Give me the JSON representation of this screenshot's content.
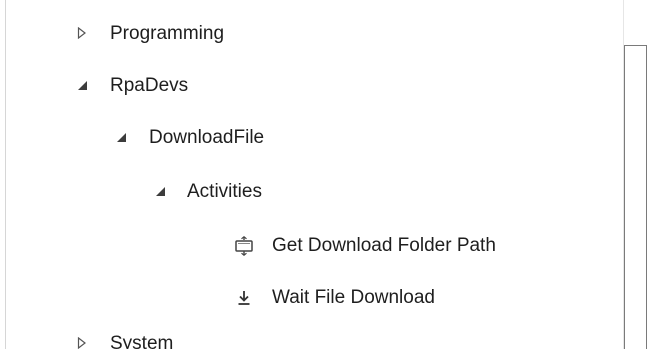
{
  "tree": {
    "items": [
      {
        "label": "Programming",
        "expanded": false,
        "icon": "triangle-right-outline-icon"
      },
      {
        "label": "RpaDevs",
        "expanded": true,
        "icon": "triangle-down-filled-icon"
      },
      {
        "label": "DownloadFile",
        "expanded": true,
        "icon": "triangle-down-filled-icon"
      },
      {
        "label": "Activities",
        "expanded": true,
        "icon": "triangle-down-filled-icon"
      },
      {
        "label": "Get Download Folder Path",
        "icon": "folder-path-icon"
      },
      {
        "label": "Wait File Download",
        "icon": "download-arrow-icon"
      },
      {
        "label": "System",
        "expanded": false,
        "icon": "triangle-right-outline-icon"
      }
    ]
  },
  "colors": {
    "text": "#1e1e1e",
    "expander": "#444444",
    "scroll_thumb_border": "#7a7a7a"
  }
}
